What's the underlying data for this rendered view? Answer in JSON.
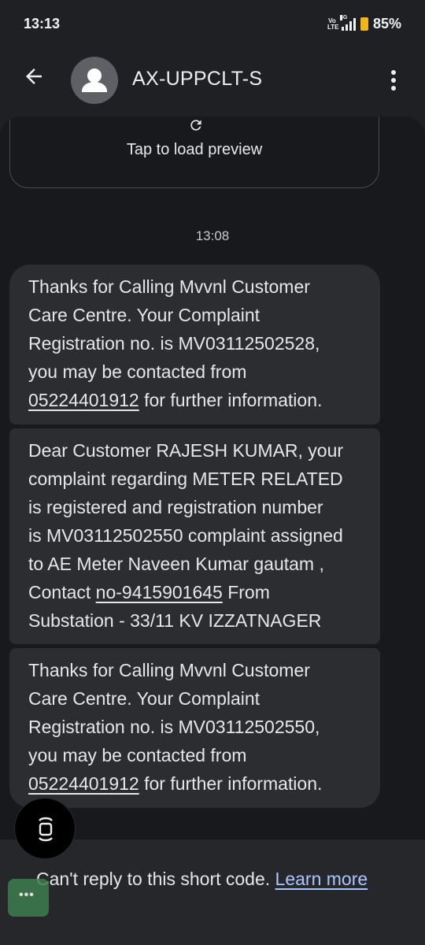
{
  "status_bar": {
    "time": "13:13",
    "volte": "Vo\nLTE",
    "network": "5G",
    "battery_percent": "85%"
  },
  "header": {
    "contact_name": "AX-UPPCLT-S",
    "icons": [
      "back-arrow-icon",
      "contact-avatar-icon",
      "more-vert-icon"
    ]
  },
  "preview": {
    "label": "Tap to load preview",
    "icon": "refresh-icon"
  },
  "thread": {
    "timestamp": "13:08",
    "messages": [
      {
        "lines": [
          "Thanks for Calling Mvvnl Customer",
          "Care Centre. Your Complaint",
          "Registration no. is MV03112502528,",
          "you may be contacted from"
        ],
        "link": "05224401912",
        "after_link": " for further information."
      },
      {
        "lines": [
          "Dear Customer RAJESH KUMAR, your",
          "complaint regarding METER RELATED",
          "is registered and registration number",
          "is MV03112502550 complaint assigned",
          "to AE Meter Naveen Kumar gautam ,"
        ],
        "prefix": "Contact ",
        "link": "no-9415901645",
        "after_link": " From",
        "last_line": "Substation - 33/11 KV IZZATNAGER"
      },
      {
        "lines": [
          "Thanks for Calling Mvvnl Customer",
          "Care Centre. Your Complaint",
          "Registration no. is MV03112502550,",
          "you may be contacted from"
        ],
        "link": "05224401912",
        "after_link": " for further information."
      }
    ]
  },
  "footer": {
    "text": "Can't reply to this short code. ",
    "link": "Learn more"
  },
  "chat_head": {
    "label": "•••"
  },
  "colors": {
    "background": "#1f2024",
    "bubble": "#2c2d31",
    "link": "#a9c7ff",
    "battery": "#f2b51a"
  }
}
